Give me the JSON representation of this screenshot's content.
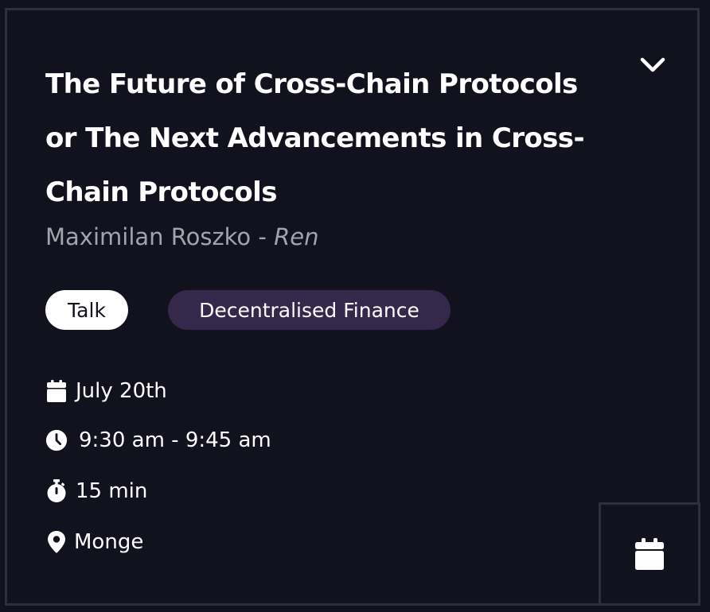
{
  "session": {
    "title": "The Future of Cross-Chain Protocols or The Next Advancements in Cross-Chain Protocols",
    "speaker_name": "Maximilan Roszko",
    "separator": " - ",
    "speaker_org": "Ren",
    "tags": {
      "type": "Talk",
      "topic": "Decentralised Finance"
    },
    "date": "July 20th",
    "time": "9:30 am - 9:45 am",
    "duration": "15 min",
    "location": "Monge"
  },
  "icons": {
    "expand": "chevron-down-icon",
    "date": "calendar-icon",
    "time": "clock-icon",
    "duration": "stopwatch-icon",
    "location": "map-pin-icon",
    "add_to_calendar": "calendar-icon"
  },
  "colors": {
    "background": "#12121f",
    "border": "#2e2f3b",
    "text": "#ffffff",
    "muted": "#a2a4ad",
    "topic_tag": "#35284a",
    "type_tag": "#ffffff"
  }
}
